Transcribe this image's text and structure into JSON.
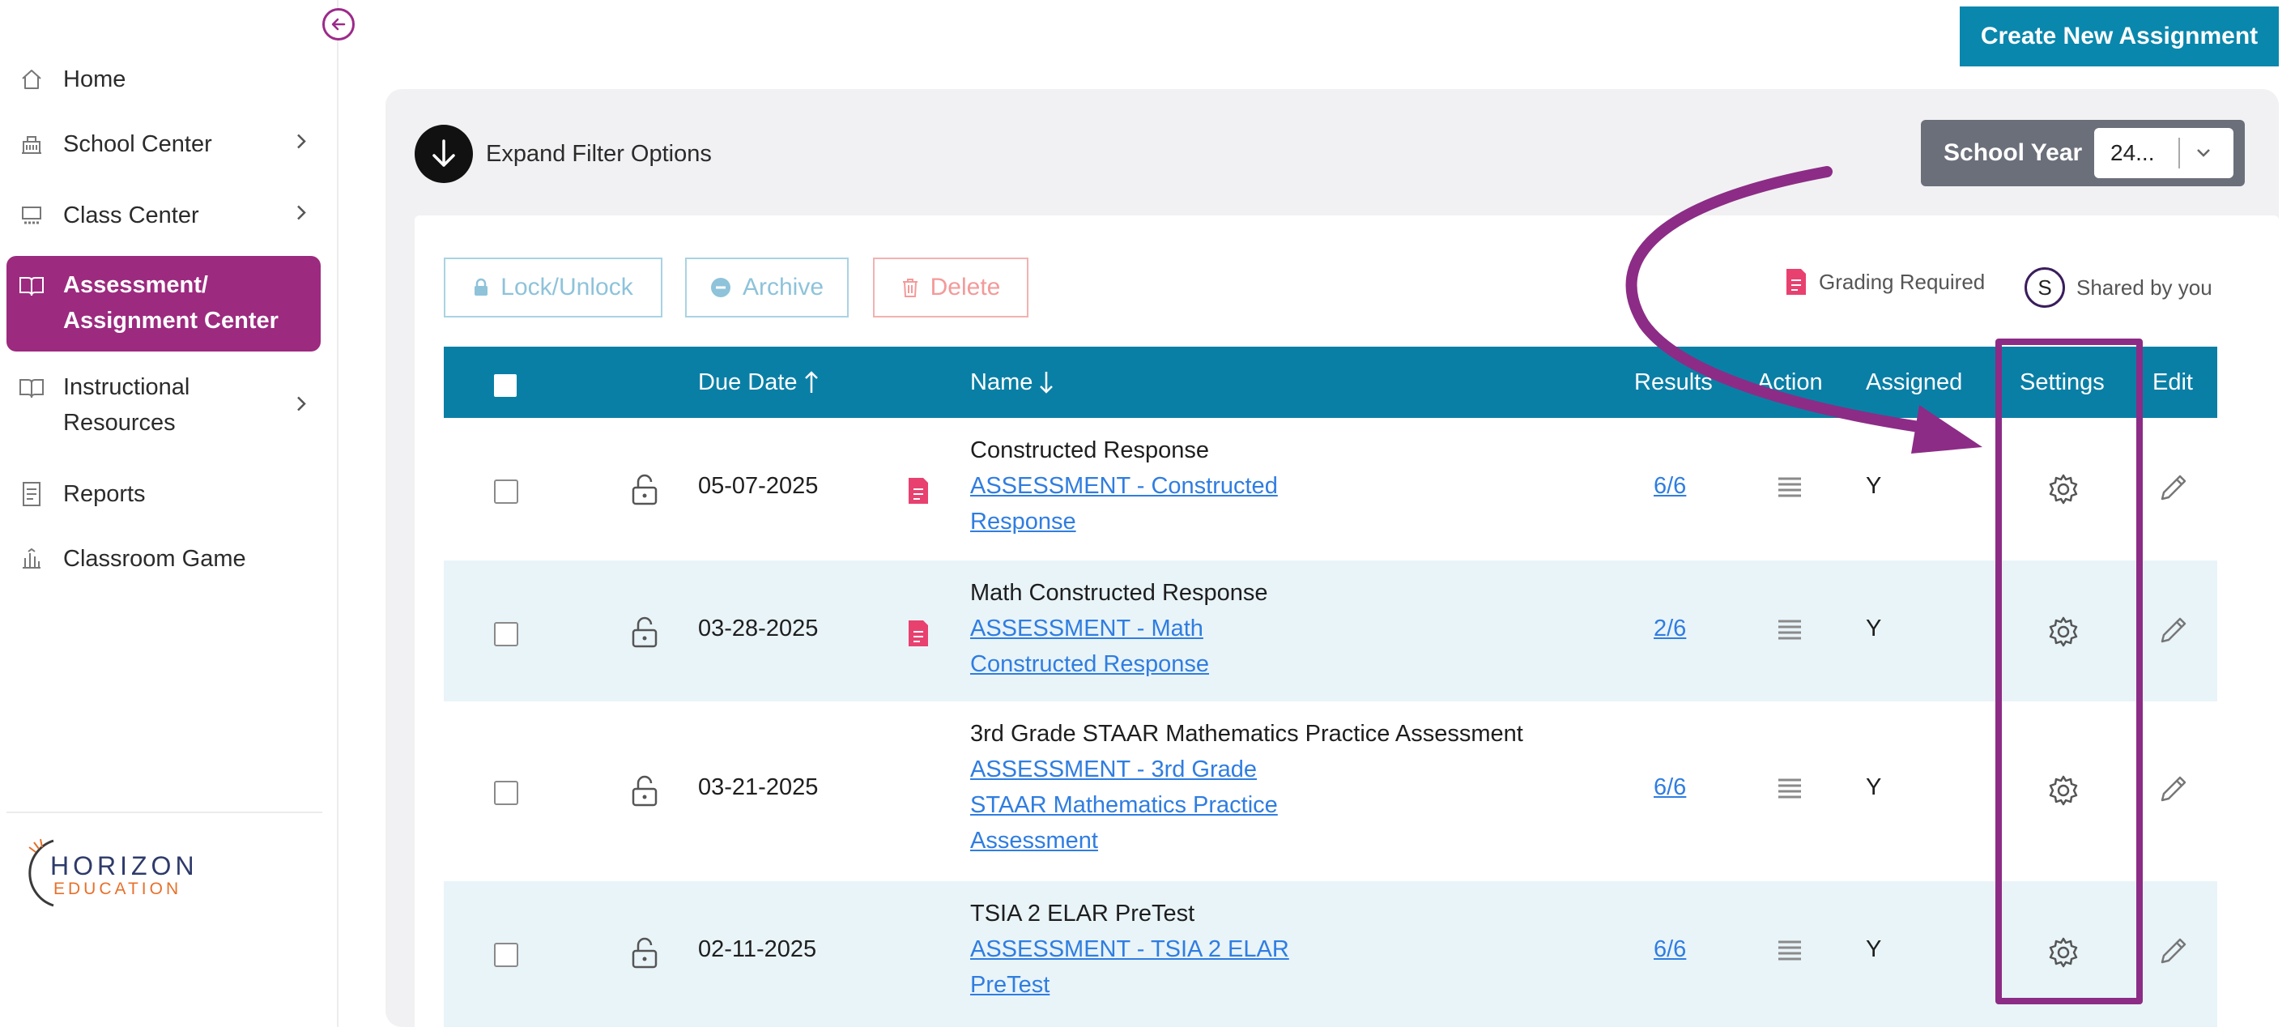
{
  "sidebar": {
    "items": [
      {
        "label": "Home",
        "icon": "home-icon"
      },
      {
        "label": "School Center",
        "icon": "school-icon"
      },
      {
        "label": "Class Center",
        "icon": "classroom-icon"
      },
      {
        "label_line1": "Assessment/",
        "label_line2": "Assignment Center",
        "icon": "book-icon",
        "active": true
      },
      {
        "label_line1": "Instructional",
        "label_line2": "Resources",
        "icon": "open-book-icon"
      },
      {
        "label": "Reports",
        "icon": "report-icon"
      },
      {
        "label": "Classroom Game",
        "icon": "game-icon"
      }
    ],
    "logo": {
      "line1": "HORIZON",
      "line2": "EDUCATION"
    }
  },
  "header": {
    "create_label": "Create New Assignment"
  },
  "filters": {
    "expand_label": "Expand Filter Options",
    "school_year_label": "School Year",
    "school_year_value": "24..."
  },
  "toolbar": {
    "lock_label": "Lock/Unlock",
    "archive_label": "Archive",
    "delete_label": "Delete",
    "legend_grading": "Grading Required",
    "legend_shared_symbol": "S",
    "legend_shared": "Shared by you"
  },
  "table": {
    "headers": {
      "due_date": "Due Date",
      "name": "Name",
      "results": "Results",
      "action": "Action",
      "assigned": "Assigned",
      "settings": "Settings",
      "edit": "Edit"
    },
    "rows": [
      {
        "due": "05-07-2025",
        "grading": true,
        "title": "Constructed Response",
        "link": [
          "ASSESSMENT - Constructed",
          "Response"
        ],
        "results": "6/6",
        "assigned": "Y"
      },
      {
        "due": "03-28-2025",
        "grading": true,
        "title": "Math Constructed Response",
        "link": [
          "ASSESSMENT - Math",
          "Constructed Response"
        ],
        "results": "2/6",
        "assigned": "Y"
      },
      {
        "due": "03-21-2025",
        "grading": false,
        "title": "3rd Grade STAAR Mathematics Practice Assessment",
        "link": [
          "ASSESSMENT - 3rd Grade",
          "STAAR Mathematics Practice",
          "Assessment"
        ],
        "results": "6/6",
        "assigned": "Y"
      },
      {
        "due": "02-11-2025",
        "grading": false,
        "title": "TSIA 2 ELAR PreTest",
        "link": [
          "ASSESSMENT - TSIA 2 ELAR",
          "PreTest"
        ],
        "results": "6/6",
        "assigned": "Y"
      }
    ]
  },
  "colors": {
    "accent": "#9c2a7f",
    "header": "#0a7fa6",
    "button": "#0a87ad",
    "annotation": "#8c2c86",
    "link": "#2f7de1"
  }
}
